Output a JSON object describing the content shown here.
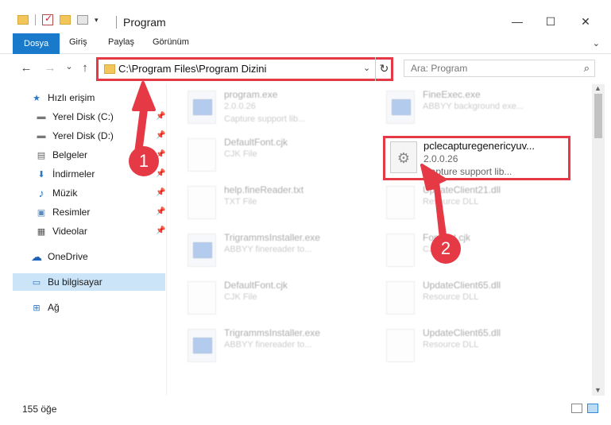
{
  "window": {
    "title": "Program",
    "minimize": "—",
    "maximize": "☐",
    "close": "✕"
  },
  "quick_access_toolbar": {
    "dropdown_glyph": "▾"
  },
  "ribbon": {
    "tabs": [
      "Dosya",
      "Giriş",
      "Paylaş",
      "Görünüm"
    ],
    "caret": "⌄"
  },
  "navigation": {
    "back": "←",
    "forward": "→",
    "recent": "⌄",
    "up": "↑",
    "address_path": "C:\\Program Files\\Program Dizini",
    "address_dropdown": "⌄",
    "refresh": "↻",
    "search_placeholder": "Ara: Program",
    "search_icon": "⌕"
  },
  "sidebar": {
    "items": [
      {
        "label": "Hızlı erişim",
        "icon": "star-icon",
        "glyph": "★",
        "pinned": false
      },
      {
        "label": "Yerel Disk (C:)",
        "icon": "drive-icon",
        "glyph": "▬",
        "pinned": true
      },
      {
        "label": "Yerel Disk (D:)",
        "icon": "drive-icon",
        "glyph": "▬",
        "pinned": true
      },
      {
        "label": "Belgeler",
        "icon": "documents-icon",
        "glyph": "▤",
        "pinned": true
      },
      {
        "label": "İndirmeler",
        "icon": "downloads-icon",
        "glyph": "⬇",
        "pinned": true
      },
      {
        "label": "Müzik",
        "icon": "music-icon",
        "glyph": "♪",
        "pinned": true
      },
      {
        "label": "Resimler",
        "icon": "pictures-icon",
        "glyph": "▣",
        "pinned": true
      },
      {
        "label": "Videolar",
        "icon": "videos-icon",
        "glyph": "▦",
        "pinned": true
      },
      {
        "label": "OneDrive",
        "icon": "cloud-icon",
        "glyph": "☁",
        "pinned": false
      },
      {
        "label": "Bu bilgisayar",
        "icon": "computer-icon",
        "glyph": "▭",
        "pinned": false
      },
      {
        "label": "Ağ",
        "icon": "network-icon",
        "glyph": "⊞",
        "pinned": false
      }
    ],
    "pin_glyph": "📌"
  },
  "files": {
    "left_column": [
      {
        "name": "program.exe",
        "line2": "2.0.0.26",
        "line3": "Capture support lib...",
        "type": "app"
      },
      {
        "name": "DefaultFont.cjk",
        "line2": "CJK File",
        "line3": "",
        "type": "doc"
      },
      {
        "name": "help.fineReader.txt",
        "line2": "TXT File",
        "line3": "",
        "type": "doc"
      },
      {
        "name": "TrigrammsInstaller.exe",
        "line2": "ABBYY finereader to...",
        "line3": "",
        "type": "app"
      },
      {
        "name": "DefaultFont.cjk",
        "line2": "CJK File",
        "line3": "",
        "type": "doc"
      },
      {
        "name": "TrigrammsInstaller.exe",
        "line2": "ABBYY finereader to...",
        "line3": "",
        "type": "app"
      }
    ],
    "right_column": [
      {
        "name": "FineExec.exe",
        "line2": "ABBYY background exe...",
        "line3": "",
        "type": "app"
      },
      {
        "name": "UpdateClient21.dll",
        "line2": "Resource DLL",
        "line3": "",
        "type": "doc"
      },
      {
        "name": "FontSet.cjk",
        "line2": "CJK File",
        "line3": "",
        "type": "doc"
      },
      {
        "name": "UpdateClient65.dll",
        "line2": "Resource DLL",
        "line3": "",
        "type": "doc"
      },
      {
        "name": "UpdateClient65.dll",
        "line2": "Resource DLL",
        "line3": "",
        "type": "doc"
      }
    ],
    "highlighted": {
      "name": "pclecapturegenericyuv...",
      "version": "2.0.0.26",
      "description": "Capture support lib..."
    }
  },
  "status_bar": {
    "item_count": "155 öğe"
  },
  "annotations": {
    "badge1": "1",
    "badge2": "2",
    "color": "#e53945"
  }
}
